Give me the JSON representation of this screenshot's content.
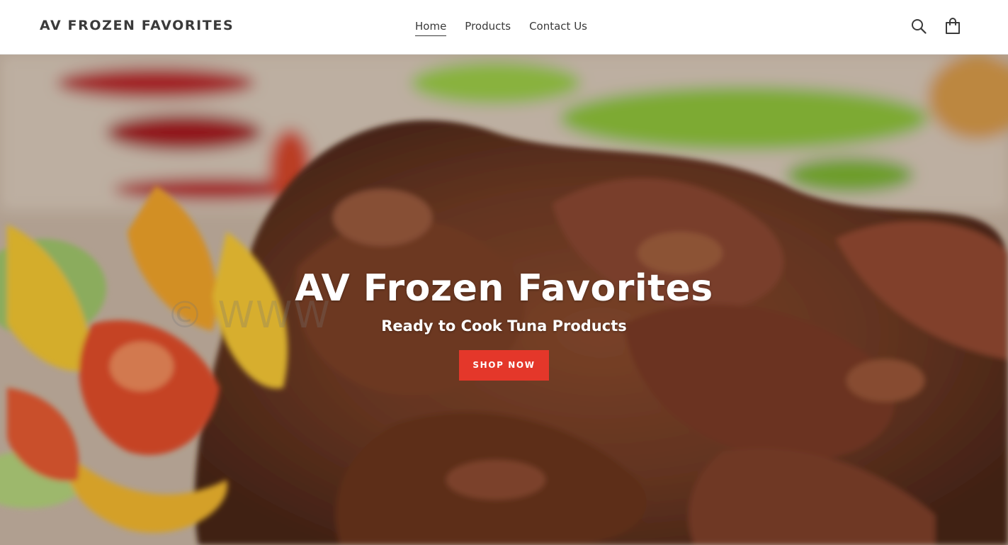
{
  "header": {
    "logo": "AV FROZEN FAVORITES",
    "nav": [
      {
        "label": "Home",
        "active": true
      },
      {
        "label": "Products",
        "active": false
      },
      {
        "label": "Contact Us",
        "active": false
      }
    ],
    "icons": [
      "search-icon",
      "cart-icon"
    ]
  },
  "hero": {
    "title": "AV Frozen Favorites",
    "subtitle": "Ready to Cook Tuna Products",
    "cta_label": "SHOP NOW",
    "watermark": "© WWW",
    "image_description_icon": "food-photo"
  },
  "colors": {
    "cta": "#e4372a",
    "text": "#3a3a3a",
    "header_bg": "#ffffff"
  }
}
